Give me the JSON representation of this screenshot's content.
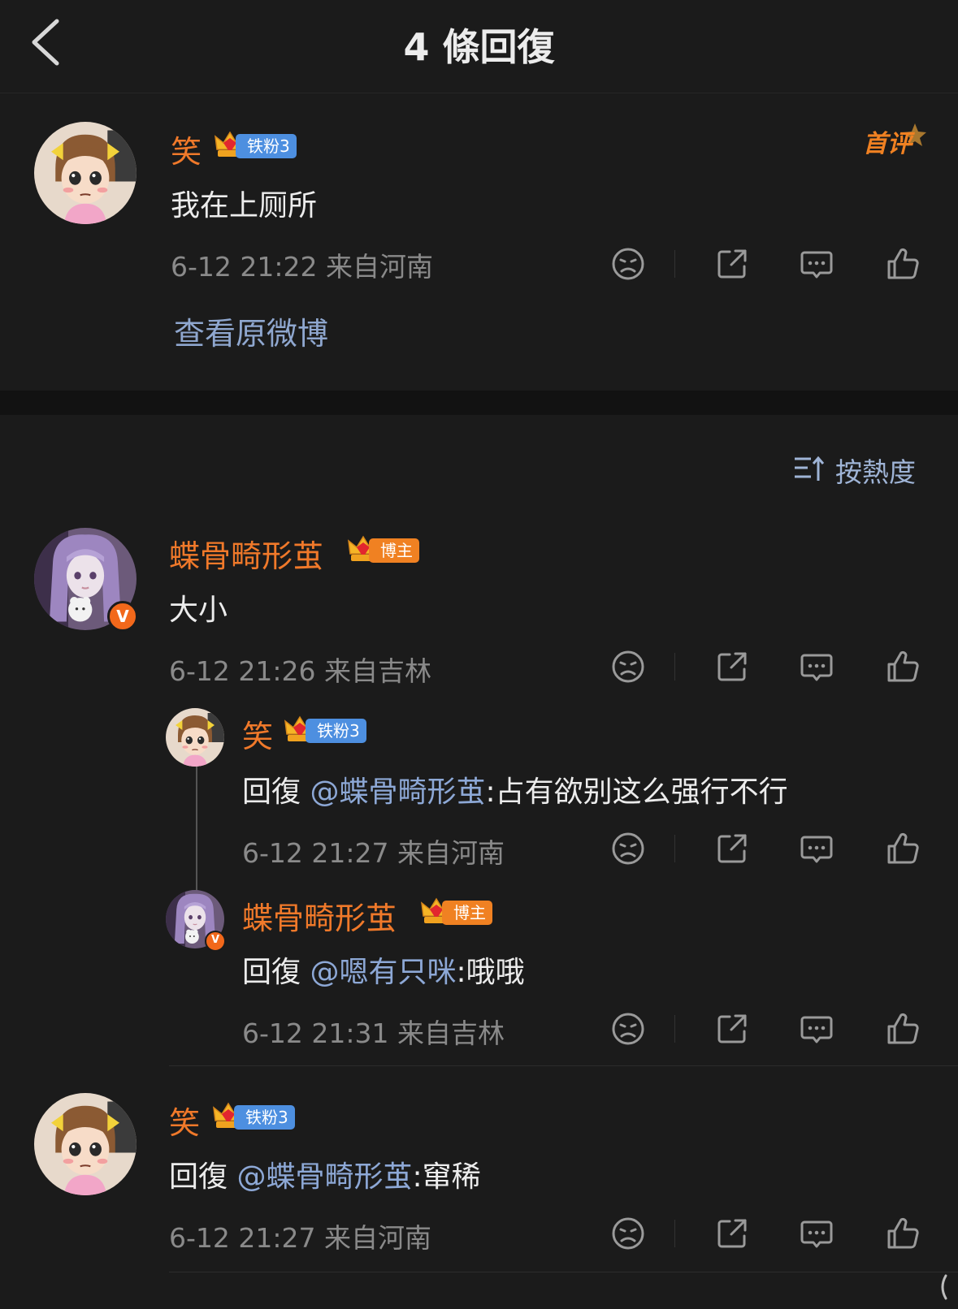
{
  "header": {
    "title": "4 條回復",
    "back_icon": "chevron-left-icon"
  },
  "root_comment": {
    "user": "笑",
    "badge": "铁粉3",
    "first_badge": "首评",
    "text": "我在上厕所",
    "meta": "6-12  21:22  来自河南",
    "view_original": "查看原微博"
  },
  "sort_label": "按熱度",
  "replies": [
    {
      "user": "蝶骨畸形茧",
      "badge": "博主",
      "verified": "V",
      "text": "大小",
      "meta": "6-12  21:26  来自吉林",
      "sub_replies": [
        {
          "user": "笑",
          "badge": "铁粉3",
          "prefix": "回復 ",
          "mention": "@蝶骨畸形茧",
          "text": ":占有欲别这么强行不行",
          "meta": "6-12  21:27  来自河南"
        },
        {
          "user": "蝶骨畸形茧",
          "badge": "博主",
          "verified": "V",
          "prefix": "回復 ",
          "mention": "@嗯有只咪",
          "text": ":哦哦",
          "meta": "6-12  21:31  来自吉林"
        }
      ]
    },
    {
      "user": "笑",
      "badge": "铁粉3",
      "prefix": "回復 ",
      "mention": "@蝶骨畸形茧",
      "text": ":窜稀",
      "meta": "6-12  21:27  来自河南"
    }
  ],
  "colors": {
    "background": "#1b1b1b",
    "username": "#f0792a",
    "mention": "#8da8d6",
    "fan_badge": "#4d8fe0",
    "host_badge": "#f08122",
    "meta": "#8a8a8a"
  }
}
